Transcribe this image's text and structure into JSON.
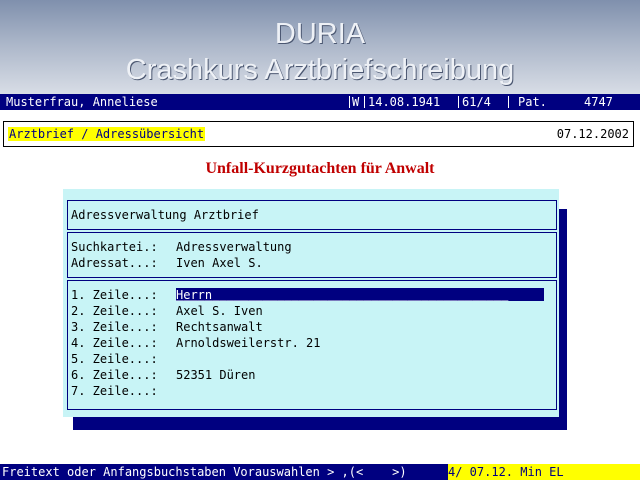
{
  "banner": {
    "title": "DURIA",
    "subtitle": "Crashkurs Arztbriefschreibung"
  },
  "patient": {
    "name": "Musterfrau, Anneliese",
    "sex": "W",
    "dob": "14.08.1941",
    "code": "61/4",
    "pat_label": "Pat.",
    "pat_no": "4747"
  },
  "header": {
    "label": "Arztbrief / Adressübersicht",
    "date": "07.12.2002"
  },
  "doc_title": "Unfall-Kurzgutachten für Anwalt",
  "dialog": {
    "title": "Adressverwaltung Arztbrief",
    "suchkartei_label": "Suchkartei.:",
    "suchkartei_value": "Adressverwaltung",
    "adressat_label": "Adressat...:",
    "adressat_value": "Iven Axel S.",
    "lines": [
      {
        "label": "1. Zeile...:",
        "value": "Herrn"
      },
      {
        "label": "2. Zeile...:",
        "value": "Axel S. Iven"
      },
      {
        "label": "3. Zeile...:",
        "value": "Rechtsanwalt"
      },
      {
        "label": "4. Zeile...:",
        "value": "Arnoldsweilerstr. 21"
      },
      {
        "label": "5. Zeile...:",
        "value": ""
      },
      {
        "label": "6. Zeile...:",
        "value": "52351 Düren"
      },
      {
        "label": "7. Zeile...:",
        "value": ""
      }
    ]
  },
  "status": {
    "left": "Freitext oder Anfangsbuchstaben Vorauswahlen > ,(<    >)",
    "right": "4/ 07.12. Min EL"
  }
}
